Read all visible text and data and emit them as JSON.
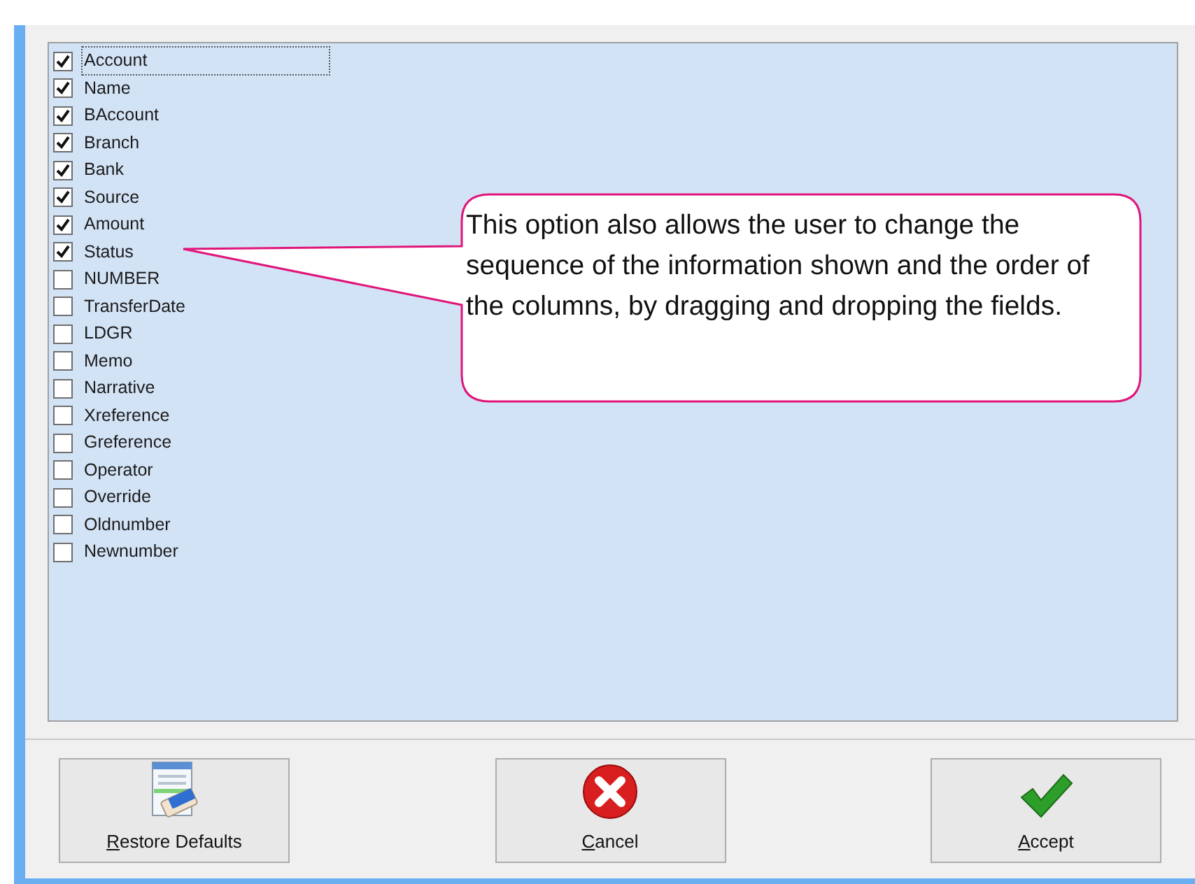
{
  "fields": [
    {
      "label": "Account",
      "checked": true,
      "focused": true
    },
    {
      "label": "Name",
      "checked": true,
      "focused": false
    },
    {
      "label": "BAccount",
      "checked": true,
      "focused": false
    },
    {
      "label": "Branch",
      "checked": true,
      "focused": false
    },
    {
      "label": "Bank",
      "checked": true,
      "focused": false
    },
    {
      "label": "Source",
      "checked": true,
      "focused": false
    },
    {
      "label": "Amount",
      "checked": true,
      "focused": false
    },
    {
      "label": "Status",
      "checked": true,
      "focused": false
    },
    {
      "label": "NUMBER",
      "checked": false,
      "focused": false
    },
    {
      "label": "TransferDate",
      "checked": false,
      "focused": false
    },
    {
      "label": "LDGR",
      "checked": false,
      "focused": false
    },
    {
      "label": "Memo",
      "checked": false,
      "focused": false
    },
    {
      "label": "Narrative",
      "checked": false,
      "focused": false
    },
    {
      "label": "Xreference",
      "checked": false,
      "focused": false
    },
    {
      "label": "Greference",
      "checked": false,
      "focused": false
    },
    {
      "label": "Operator",
      "checked": false,
      "focused": false
    },
    {
      "label": "Override",
      "checked": false,
      "focused": false
    },
    {
      "label": "Oldnumber",
      "checked": false,
      "focused": false
    },
    {
      "label": "Newnumber",
      "checked": false,
      "focused": false
    }
  ],
  "callout": {
    "text": "This option also allows the user to change the sequence of the information shown and the order of the columns, by dragging and dropping the fields."
  },
  "buttons": [
    {
      "kind": "restore",
      "label": "Restore Defaults",
      "mnemonic_underlined": true
    },
    {
      "kind": "cancel",
      "label": "Cancel",
      "mnemonic_underlined": true
    },
    {
      "kind": "accept",
      "label": "Accept",
      "mnemonic_underlined": true
    }
  ]
}
